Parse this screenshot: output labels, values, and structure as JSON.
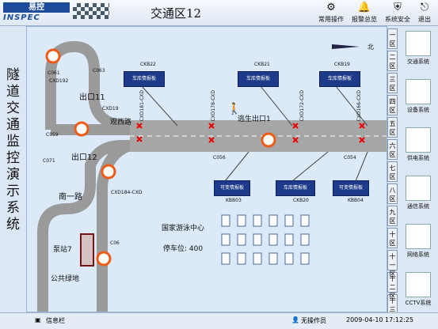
{
  "header": {
    "logo_top": "易控",
    "logo_bottom": "INSPEC",
    "title": "交通区12",
    "buttons": [
      {
        "label": "常用操作",
        "icon": "gear-icon"
      },
      {
        "label": "报警总览",
        "icon": "bell-icon"
      },
      {
        "label": "系统安全",
        "icon": "shield-icon"
      },
      {
        "label": "退出",
        "icon": "exit-icon"
      }
    ]
  },
  "sidebar_left": {
    "chars": [
      "隧",
      "道",
      "交",
      "通",
      "监",
      "控",
      "演",
      "示",
      "系",
      "统"
    ]
  },
  "zone_tabs": [
    "一区",
    "二区",
    "三区",
    "四区",
    "五区",
    "六区",
    "七区",
    "八区",
    "九区",
    "十区",
    "十一区",
    "十二区",
    "十三区"
  ],
  "system_buttons": [
    "交通系统",
    "设备系统",
    "供电系统",
    "通信系统",
    "网络系统",
    "CCTV系统"
  ],
  "map": {
    "compass": "北",
    "labels": {
      "exit11": "出口11",
      "exit12": "出口12",
      "guanxi_road": "观西路",
      "nanyi_road": "南一路",
      "escape_exit": "逃生出口1",
      "pump_station": "泵站7",
      "public_green": "公共绿地",
      "swim_center": "国家游泳中心",
      "parking": "停车位: 400"
    },
    "codes": {
      "c061": "C061",
      "c063": "C063",
      "cxd192": "CXD192",
      "c059": "C059",
      "c071": "C071",
      "c06": "C06",
      "cxd19": "CXD19",
      "cxd184": "CXD184-CXD",
      "cxd181": "CXD181-CXD",
      "cxd178": "CXD178-CXD",
      "cxd172": "CXD172-CXD",
      "cxd166": "CXD166-CXD",
      "ckb22": "CKB22",
      "ckb21": "CKB21",
      "ckb19": "CKB19",
      "c056": "C056",
      "c054": "C054",
      "kbb03": "KBB03",
      "ckb20": "CKB20",
      "kbb04": "KBB04"
    },
    "signs": {
      "lane_board": "车库情报板",
      "variable_board": "可变情报板"
    }
  },
  "status": {
    "info_bar": "信息栏",
    "operator": "无操作员",
    "datetime": "2009-04-10  17:12:25"
  }
}
